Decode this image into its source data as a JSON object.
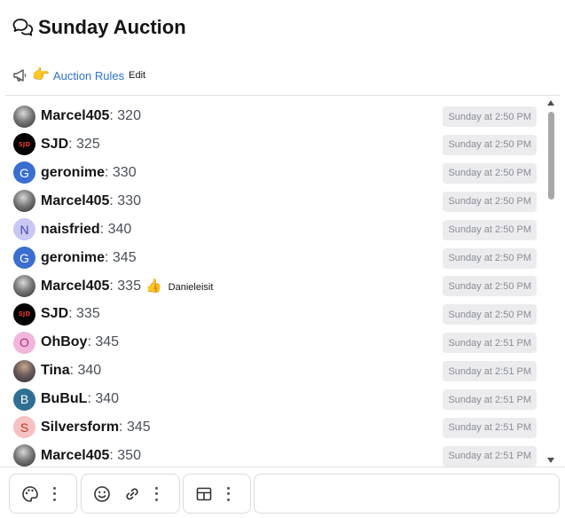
{
  "header": {
    "title": "Sunday Auction",
    "icon": "chat-bubbles-icon"
  },
  "rules": {
    "link_label": "Auction Rules",
    "edit_label": "Edit"
  },
  "messages": [
    {
      "user": "Marcel405",
      "value": ": 320",
      "time": "Sunday at 2:50 PM",
      "avatar": "photo"
    },
    {
      "user": "SJD",
      "value": ": 325",
      "time": "Sunday at 2:50 PM",
      "avatar": "sjd",
      "avatar_text": "SJD"
    },
    {
      "user": "geronime",
      "value": ": 330",
      "time": "Sunday at 2:50 PM",
      "avatar": "letter",
      "letter": "G",
      "bg": "#3a6fd1",
      "fg": "#ffffff"
    },
    {
      "user": "Marcel405",
      "value": ": 330",
      "time": "Sunday at 2:50 PM",
      "avatar": "photo"
    },
    {
      "user": "naisfried",
      "value": ": 340",
      "time": "Sunday at 2:50 PM",
      "avatar": "letter",
      "letter": "N",
      "bg": "#c9c8f2",
      "fg": "#4a45b5"
    },
    {
      "user": "geronime",
      "value": ": 345",
      "time": "Sunday at 2:50 PM",
      "avatar": "letter",
      "letter": "G",
      "bg": "#3a6fd1",
      "fg": "#ffffff"
    },
    {
      "user": "Marcel405",
      "value": ": 335",
      "time": "Sunday at 2:50 PM",
      "avatar": "photo",
      "reaction": "👍",
      "reactor": "Danieleisit"
    },
    {
      "user": "SJD",
      "value": ": 335",
      "time": "Sunday at 2:50 PM",
      "avatar": "sjd",
      "avatar_text": "SJD"
    },
    {
      "user": "OhBoy",
      "value": ": 345",
      "time": "Sunday at 2:51 PM",
      "avatar": "letter",
      "letter": "O",
      "bg": "#f0b6dc",
      "fg": "#b0307d"
    },
    {
      "user": "Tina",
      "value": ": 340",
      "time": "Sunday at 2:51 PM",
      "avatar": "tina"
    },
    {
      "user": "BuBuL",
      "value": ": 340",
      "time": "Sunday at 2:51 PM",
      "avatar": "letter",
      "letter": "B",
      "bg": "#2e6f93",
      "fg": "#ffffff"
    },
    {
      "user": "Silversform",
      "value": ": 345",
      "time": "Sunday at 2:51 PM",
      "avatar": "letter",
      "letter": "S",
      "bg": "#f6c2c2",
      "fg": "#c0392b"
    },
    {
      "user": "Marcel405",
      "value": ": 350",
      "time": "Sunday at 2:51 PM",
      "avatar": "photo"
    }
  ],
  "toolbar": {
    "groups": [
      {
        "buttons": [
          "palette-icon"
        ]
      },
      {
        "buttons": [
          "smiley-icon",
          "link-icon"
        ]
      },
      {
        "buttons": [
          "table-icon"
        ]
      }
    ]
  },
  "colors": {
    "link": "#2f73d0",
    "timestamp_bg": "#ececef",
    "timestamp_text": "#8a8d96"
  }
}
